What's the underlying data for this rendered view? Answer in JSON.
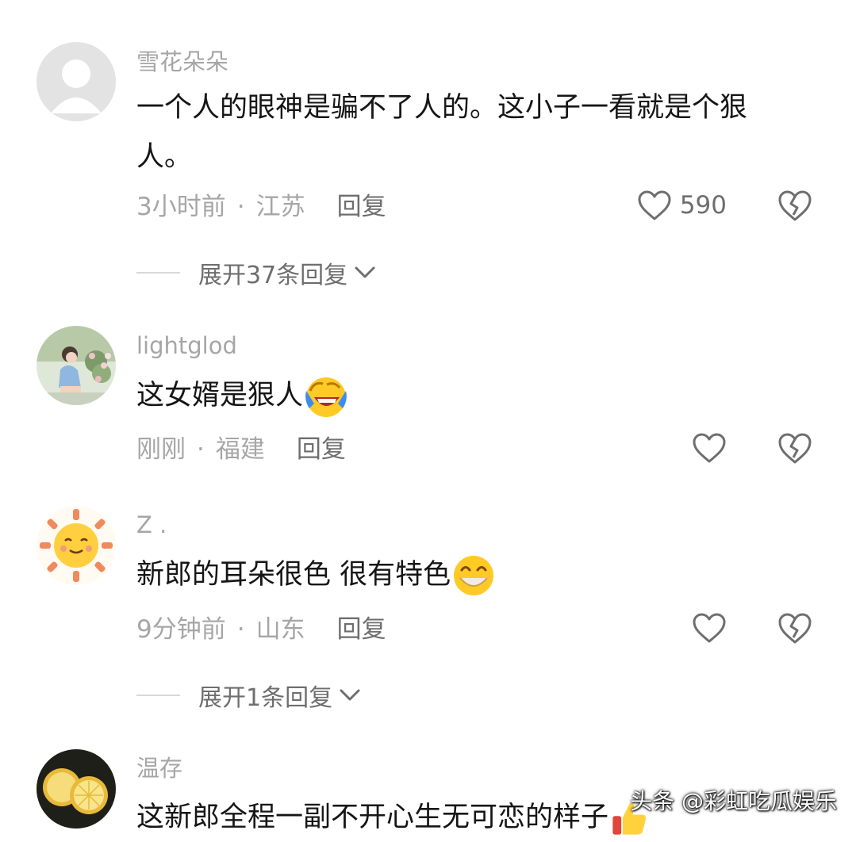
{
  "comments": [
    {
      "username": "雪花朵朵",
      "text": "一个人的眼神是骗不了人的。这小子一看就是个狠人。",
      "time": "3小时前",
      "location": "江苏",
      "reply": "回复",
      "likes": "590",
      "expand": "展开37条回复"
    },
    {
      "username": "lightglod",
      "text": "这女婿是狠人",
      "time": "刚刚",
      "location": "福建",
      "reply": "回复"
    },
    {
      "username": "Z .",
      "text": "新郎的耳朵很色 很有特色",
      "time": "9分钟前",
      "location": "山东",
      "reply": "回复",
      "expand": "展开1条回复"
    },
    {
      "username": "温存",
      "text": "这新郎全程一副不开心生无可恋的样子"
    }
  ],
  "dot": "·",
  "watermark": "头条 @彩虹吃瓜娱乐",
  "colors": {
    "meta": "#a6a6a6",
    "text": "#161616",
    "action": "#6e6e6e"
  },
  "icons": [
    "heart-icon",
    "broken-heart-icon",
    "chevron-down-icon",
    "laugh-cry-emoji",
    "grin-emoji",
    "thumbs-up-emoji"
  ]
}
